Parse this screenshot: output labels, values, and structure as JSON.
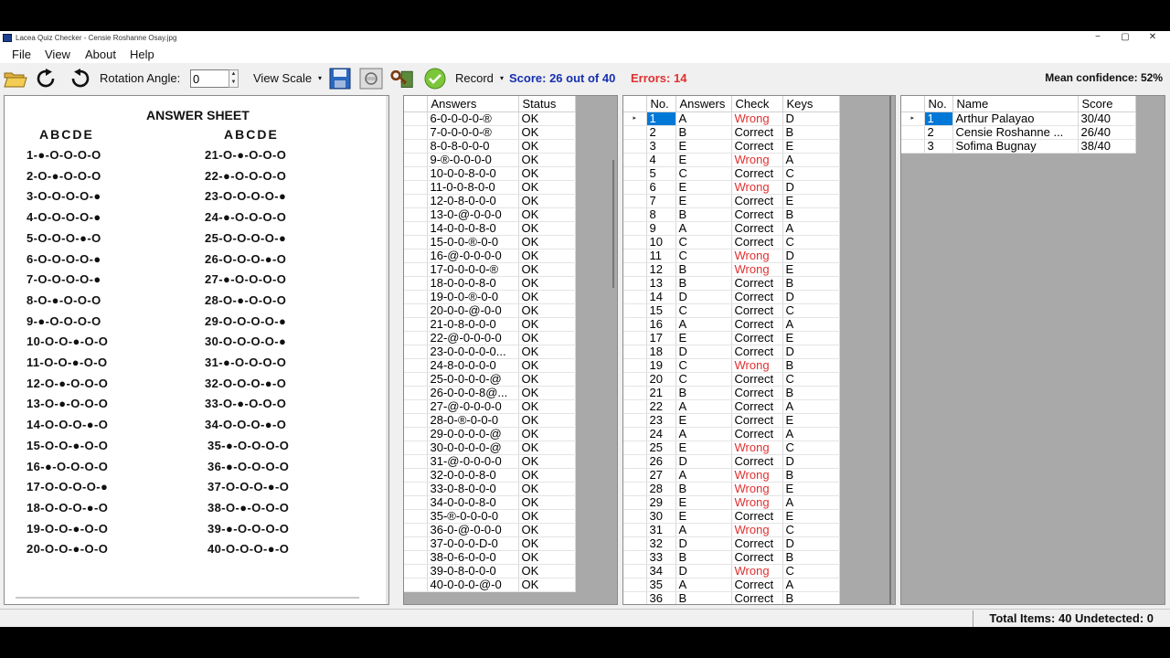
{
  "window": {
    "title": "Lacea Quiz Checker - Censie Roshanne Osay.jpg",
    "minimize": "−",
    "maximize": "▢",
    "close": "✕"
  },
  "menu": [
    "File",
    "View",
    "About",
    "Help"
  ],
  "toolbar": {
    "rotation_label": "Rotation Angle:",
    "rotation_value": "0",
    "view_scale_label": "View Scale",
    "record_label": "Record",
    "score_text": "Score: 26 out of 40",
    "errors_text": "Errors: 14",
    "mean_confidence": "Mean confidence: 52%",
    "icons": [
      "open-folder-icon",
      "rotate-clockwise-icon",
      "rotate-counterclockwise-icon",
      "save-icon",
      "scan-icon",
      "key-icon",
      "check-icon"
    ]
  },
  "sheet": {
    "title": "ANSWER SHEET",
    "col_header": "ABCDE",
    "rows_left": [
      "1-●-O-O-O-O",
      "2-O-●-O-O-O",
      "3-O-O-O-O-●",
      "4-O-O-O-O-●",
      "5-O-O-O-●-O",
      "6-O-O-O-O-●",
      "7-O-O-O-O-●",
      "8-O-●-O-O-O",
      "9-●-O-O-O-O",
      "10-O-O-●-O-O",
      "11-O-O-●-O-O",
      "12-O-●-O-O-O",
      "13-O-●-O-O-O",
      "14-O-O-O-●-O",
      "15-O-O-●-O-O",
      "16-●-O-O-O-O",
      "17-O-O-O-O-●",
      "18-O-O-O-●-O",
      "19-O-O-●-O-O",
      "20-O-O-●-O-O"
    ],
    "rows_right": [
      "21-O-●-O-O-O",
      "22-●-O-O-O-O",
      "23-O-O-O-O-●",
      "24-●-O-O-O-O",
      "25-O-O-O-O-●",
      "26-O-O-O-●-O",
      "27-●-O-O-O-O",
      "28-O-●-O-O-O",
      "29-O-O-O-O-●",
      "30-O-O-O-O-●",
      "31-●-O-O-O-O",
      "32-O-O-O-●-O",
      "33-O-●-O-O-O",
      "34-O-O-O-●-O",
      "35-●-O-O-O-O",
      "36-●-O-O-O-O",
      "37-O-O-O-●-O",
      "38-O-●-O-O-O",
      "39-●-O-O-O-O",
      "40-O-O-O-●-O"
    ]
  },
  "answers_table": {
    "headers": [
      "Answers",
      "Status"
    ],
    "selected_index": 36,
    "rows": [
      [
        "6-0-0-0-0-®",
        "OK"
      ],
      [
        "7-0-0-0-0-®",
        "OK"
      ],
      [
        "8-0-8-0-0-0",
        "OK"
      ],
      [
        "9-®-0-0-0-0",
        "OK"
      ],
      [
        "10-0-0-8-0-0",
        "OK"
      ],
      [
        "11-0-0-8-0-0",
        "OK"
      ],
      [
        "12-0-8-0-0-0",
        "OK"
      ],
      [
        "13-0-@-0-0-0",
        "OK"
      ],
      [
        "14-0-0-0-8-0",
        "OK"
      ],
      [
        "15-0-0-®-0-0",
        "OK"
      ],
      [
        "16-@-0-0-0-0",
        "OK"
      ],
      [
        "17-0-0-0-0-®",
        "OK"
      ],
      [
        "18-0-0-0-8-0",
        "OK"
      ],
      [
        "19-0-0-®-0-0",
        "OK"
      ],
      [
        "20-0-0-@-0-0",
        "OK"
      ],
      [
        "21-0-8-0-0-0",
        "OK"
      ],
      [
        "22-@-0-0-0-0",
        "OK"
      ],
      [
        "23-0-0-0-0-0...",
        "OK"
      ],
      [
        "24-8-0-0-0-0",
        "OK"
      ],
      [
        "25-0-0-0-0-@",
        "OK"
      ],
      [
        "26-0-0-0-8@...",
        "OK"
      ],
      [
        "27-@-0-0-0-0",
        "OK"
      ],
      [
        "28-0-®-0-0-0",
        "OK"
      ],
      [
        "29-0-0-0-0-@",
        "OK"
      ],
      [
        "30-0-0-0-0-@",
        "OK"
      ],
      [
        "31-@-0-0-0-0",
        "OK"
      ],
      [
        "32-0-0-0-8-0",
        "OK"
      ],
      [
        "33-0-8-0-0-0",
        "OK"
      ],
      [
        "34-0-0-0-8-0",
        "OK"
      ],
      [
        "35-®-0-0-0-0",
        "OK"
      ],
      [
        "36-0-@-0-0-0",
        "OK"
      ],
      [
        "37-0-0-0-D-0",
        "OK"
      ],
      [
        "38-0-6-0-0-0",
        "OK"
      ],
      [
        "39-0-8-0-0-0",
        "OK"
      ],
      [
        "40-0-0-0-@-0",
        "OK"
      ]
    ]
  },
  "check_table": {
    "headers": [
      "No.",
      "Answers",
      "Check",
      "Keys"
    ],
    "rows": [
      [
        "1",
        "A",
        "Wrong",
        "D"
      ],
      [
        "2",
        "B",
        "Correct",
        "B"
      ],
      [
        "3",
        "E",
        "Correct",
        "E"
      ],
      [
        "4",
        "E",
        "Wrong",
        "A"
      ],
      [
        "5",
        "C",
        "Correct",
        "C"
      ],
      [
        "6",
        "E",
        "Wrong",
        "D"
      ],
      [
        "7",
        "E",
        "Correct",
        "E"
      ],
      [
        "8",
        "B",
        "Correct",
        "B"
      ],
      [
        "9",
        "A",
        "Correct",
        "A"
      ],
      [
        "10",
        "C",
        "Correct",
        "C"
      ],
      [
        "11",
        "C",
        "Wrong",
        "D"
      ],
      [
        "12",
        "B",
        "Wrong",
        "E"
      ],
      [
        "13",
        "B",
        "Correct",
        "B"
      ],
      [
        "14",
        "D",
        "Correct",
        "D"
      ],
      [
        "15",
        "C",
        "Correct",
        "C"
      ],
      [
        "16",
        "A",
        "Correct",
        "A"
      ],
      [
        "17",
        "E",
        "Correct",
        "E"
      ],
      [
        "18",
        "D",
        "Correct",
        "D"
      ],
      [
        "19",
        "C",
        "Wrong",
        "B"
      ],
      [
        "20",
        "C",
        "Correct",
        "C"
      ],
      [
        "21",
        "B",
        "Correct",
        "B"
      ],
      [
        "22",
        "A",
        "Correct",
        "A"
      ],
      [
        "23",
        "E",
        "Correct",
        "E"
      ],
      [
        "24",
        "A",
        "Correct",
        "A"
      ],
      [
        "25",
        "E",
        "Wrong",
        "C"
      ],
      [
        "26",
        "D",
        "Correct",
        "D"
      ],
      [
        "27",
        "A",
        "Wrong",
        "B"
      ],
      [
        "28",
        "B",
        "Wrong",
        "E"
      ],
      [
        "29",
        "E",
        "Wrong",
        "A"
      ],
      [
        "30",
        "E",
        "Correct",
        "E"
      ],
      [
        "31",
        "A",
        "Wrong",
        "C"
      ],
      [
        "32",
        "D",
        "Correct",
        "D"
      ],
      [
        "33",
        "B",
        "Correct",
        "B"
      ],
      [
        "34",
        "D",
        "Wrong",
        "C"
      ],
      [
        "35",
        "A",
        "Correct",
        "A"
      ],
      [
        "36",
        "B",
        "Correct",
        "B"
      ]
    ]
  },
  "names_table": {
    "headers": [
      "No.",
      "Name",
      "Score"
    ],
    "rows": [
      [
        "1",
        "Arthur Palayao",
        "30/40"
      ],
      [
        "2",
        "Censie Roshanne ...",
        "26/40"
      ],
      [
        "3",
        "Sofima Bugnay",
        "38/40"
      ]
    ]
  },
  "status": {
    "text": "Total Items: 40 Undetected: 0"
  },
  "colors": {
    "selection": "#0078d7",
    "score": "#1530b0",
    "error": "#e03030"
  }
}
